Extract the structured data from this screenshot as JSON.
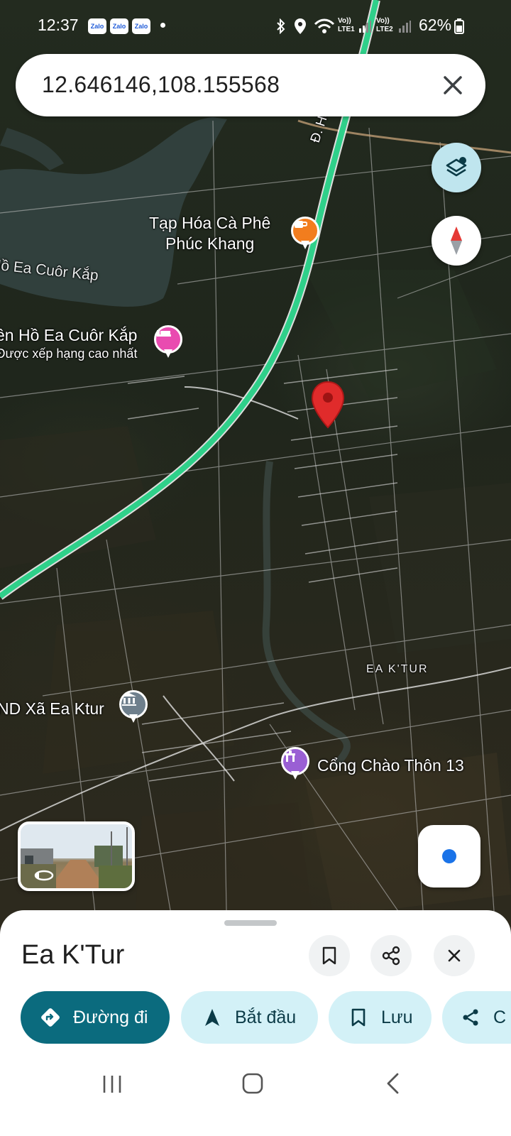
{
  "status_bar": {
    "time": "12:37",
    "notification_apps": [
      "Zalo",
      "Zalo",
      "Zalo"
    ],
    "sim1": "Vo))\nLTE1",
    "sim2": "Vo))\nLTE2",
    "battery": "62%"
  },
  "search": {
    "query": "12.646146,108.155568",
    "clear_icon": "close-icon"
  },
  "map": {
    "road_label": "Đ. Hồ Chí",
    "lake_label": "Hồ Ea Cuôr Kắp",
    "places": [
      {
        "name_line1": "Tạp Hóa Cà Phê",
        "name_line2": "Phúc Khang",
        "icon": "coffee-icon",
        "color": "#f27d1e"
      },
      {
        "name_line1": "ên Hồ Ea Cuôr Kắp",
        "name_line2": "Được xếp hạng cao nhất",
        "icon": "hotel-bed-icon",
        "color": "#e94bb0"
      },
      {
        "name_line1": "ND Xã Ea Ktur",
        "icon": "government-building-icon",
        "color": "#6e7f8c"
      },
      {
        "name_line1": "Cổng Chào Thôn 13",
        "icon": "landmark-gate-icon",
        "color": "#9a5fd4"
      }
    ],
    "area_label": "EA K'TUR",
    "pin_color": "#e02b2b",
    "route_color": "#2fd08a"
  },
  "controls": {
    "layers_icon": "layers-icon",
    "compass_icon": "compass-icon",
    "my_location_icon": "my-location-icon",
    "street_view_icon": "street-view-rotate-icon"
  },
  "sheet": {
    "title": "Ea K'Tur",
    "actions": {
      "save_icon": "bookmark-icon",
      "share_icon": "share-icon",
      "close_icon": "close-icon"
    },
    "chips": [
      {
        "label": "Đường đi",
        "icon": "directions-icon"
      },
      {
        "label": "Bắt đầu",
        "icon": "navigation-arrow-icon"
      },
      {
        "label": "Lưu",
        "icon": "bookmark-icon"
      },
      {
        "label": "C",
        "icon": "share-icon"
      }
    ]
  },
  "navbar": {
    "recents_icon": "recents-icon",
    "home_icon": "home-icon",
    "back_icon": "back-icon"
  },
  "colors": {
    "primary_chip": "#0b6b7e",
    "secondary_chip": "#d3f1f7",
    "layers_button": "#bfe5ee"
  }
}
